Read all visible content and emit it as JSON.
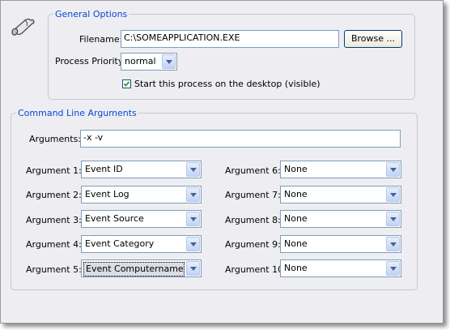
{
  "general": {
    "legend": "General Options",
    "filename_label": "Filename:",
    "filename_value": "C:\\SOMEAPPLICATION.EXE",
    "browse_label": "Browse ...",
    "priority_label": "Process Priority:",
    "priority_value": "normal",
    "desktop_checkbox_label": "Start this process on the desktop (visible)",
    "desktop_checked": true
  },
  "cmdline": {
    "legend": "Command Line Arguments",
    "arguments_label": "Arguments:",
    "arguments_value": "-x -v",
    "args_left": [
      {
        "label": "Argument 1:",
        "value": "Event ID"
      },
      {
        "label": "Argument 2:",
        "value": "Event Log"
      },
      {
        "label": "Argument 3:",
        "value": "Event Source"
      },
      {
        "label": "Argument 4:",
        "value": "Event Category"
      },
      {
        "label": "Argument 5:",
        "value": "Event Computername"
      }
    ],
    "args_right": [
      {
        "label": "Argument 6:",
        "value": "None"
      },
      {
        "label": "Argument 7:",
        "value": "None"
      },
      {
        "label": "Argument 8:",
        "value": "None"
      },
      {
        "label": "Argument 9:",
        "value": "None"
      },
      {
        "label": "Argument 10:",
        "value": "None"
      }
    ]
  },
  "icons": {
    "app": "scroll-icon",
    "dropdown": "chevron-down-icon",
    "check": "checkmark-icon"
  },
  "colors": {
    "legend_text": "#0a46d5",
    "panel_bg": "#eeeef2",
    "input_border": "#7f9db9"
  }
}
